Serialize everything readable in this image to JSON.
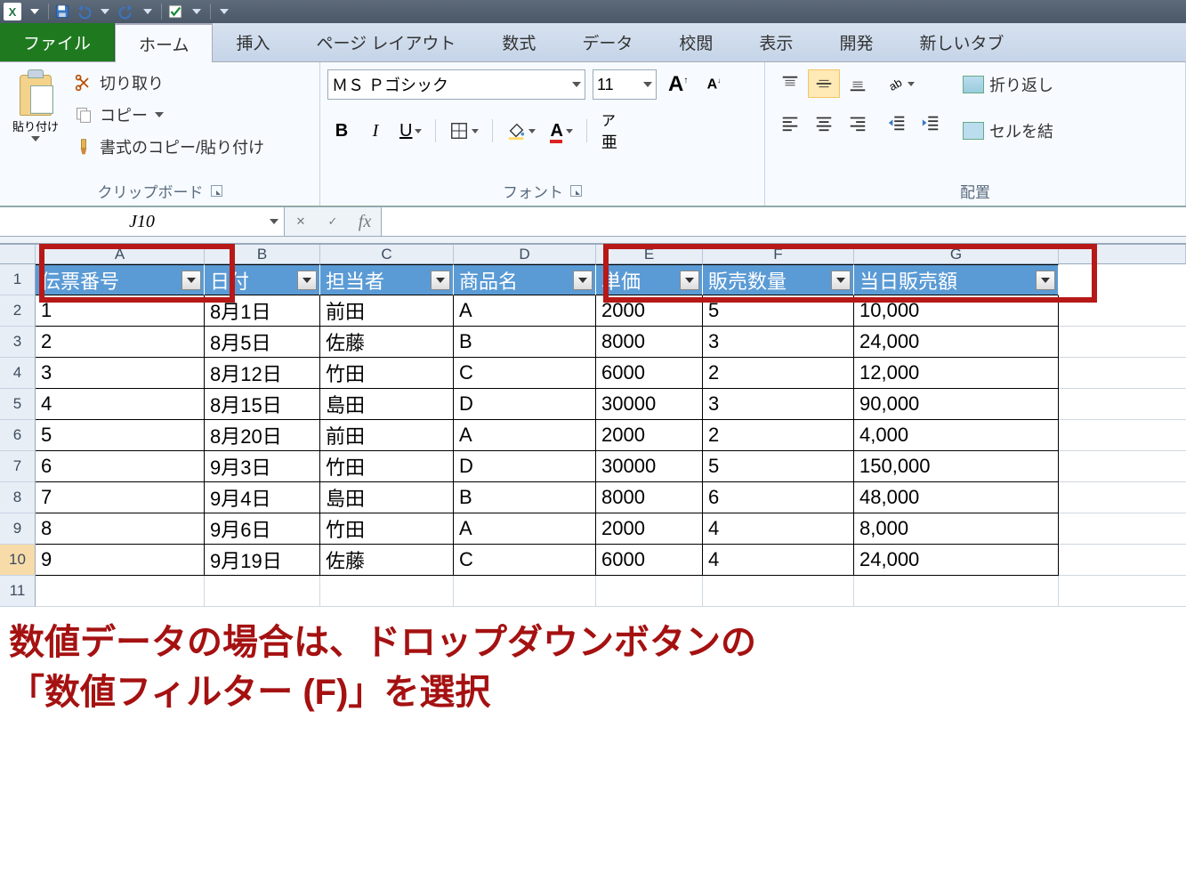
{
  "qat": {},
  "tabs": {
    "file": "ファイル",
    "home": "ホーム",
    "insert": "挿入",
    "page_layout": "ページ レイアウト",
    "formula": "数式",
    "data": "データ",
    "review": "校閲",
    "view": "表示",
    "developer": "開発",
    "new_tab": "新しいタブ"
  },
  "ribbon": {
    "clipboard": {
      "paste": "貼り付け",
      "cut": "切り取り",
      "copy": "コピー",
      "format_painter": "書式のコピー/貼り付け",
      "label": "クリップボード"
    },
    "font": {
      "name": "ＭＳ Ｐゴシック",
      "size": "11",
      "label": "フォント"
    },
    "align": {
      "wrap": "折り返し",
      "merge": "セルを結",
      "label": "配置"
    }
  },
  "formula_bar": {
    "name_box": "J10",
    "fx": "fx"
  },
  "columns": [
    "A",
    "B",
    "C",
    "D",
    "E",
    "F",
    "G"
  ],
  "headers": [
    "伝票番号",
    "日付",
    "担当者",
    "商品名",
    "単価",
    "販売数量",
    "当日販売額"
  ],
  "rows": [
    [
      "1",
      "8月1日",
      "前田",
      "A",
      "2000",
      "5",
      "10,000"
    ],
    [
      "2",
      "8月5日",
      "佐藤",
      "B",
      "8000",
      "3",
      "24,000"
    ],
    [
      "3",
      "8月12日",
      "竹田",
      "C",
      "6000",
      "2",
      "12,000"
    ],
    [
      "4",
      "8月15日",
      "島田",
      "D",
      "30000",
      "3",
      "90,000"
    ],
    [
      "5",
      "8月20日",
      "前田",
      "A",
      "2000",
      "2",
      "4,000"
    ],
    [
      "6",
      "9月3日",
      "竹田",
      "D",
      "30000",
      "5",
      "150,000"
    ],
    [
      "7",
      "9月4日",
      "島田",
      "B",
      "8000",
      "6",
      "48,000"
    ],
    [
      "8",
      "9月6日",
      "竹田",
      "A",
      "2000",
      "4",
      "8,000"
    ],
    [
      "9",
      "9月19日",
      "佐藤",
      "C",
      "6000",
      "4",
      "24,000"
    ]
  ],
  "caption": {
    "line1": "数値データの場合は、ドロップダウンボタンの",
    "line2": "「数値フィルター (F)」を選択"
  }
}
